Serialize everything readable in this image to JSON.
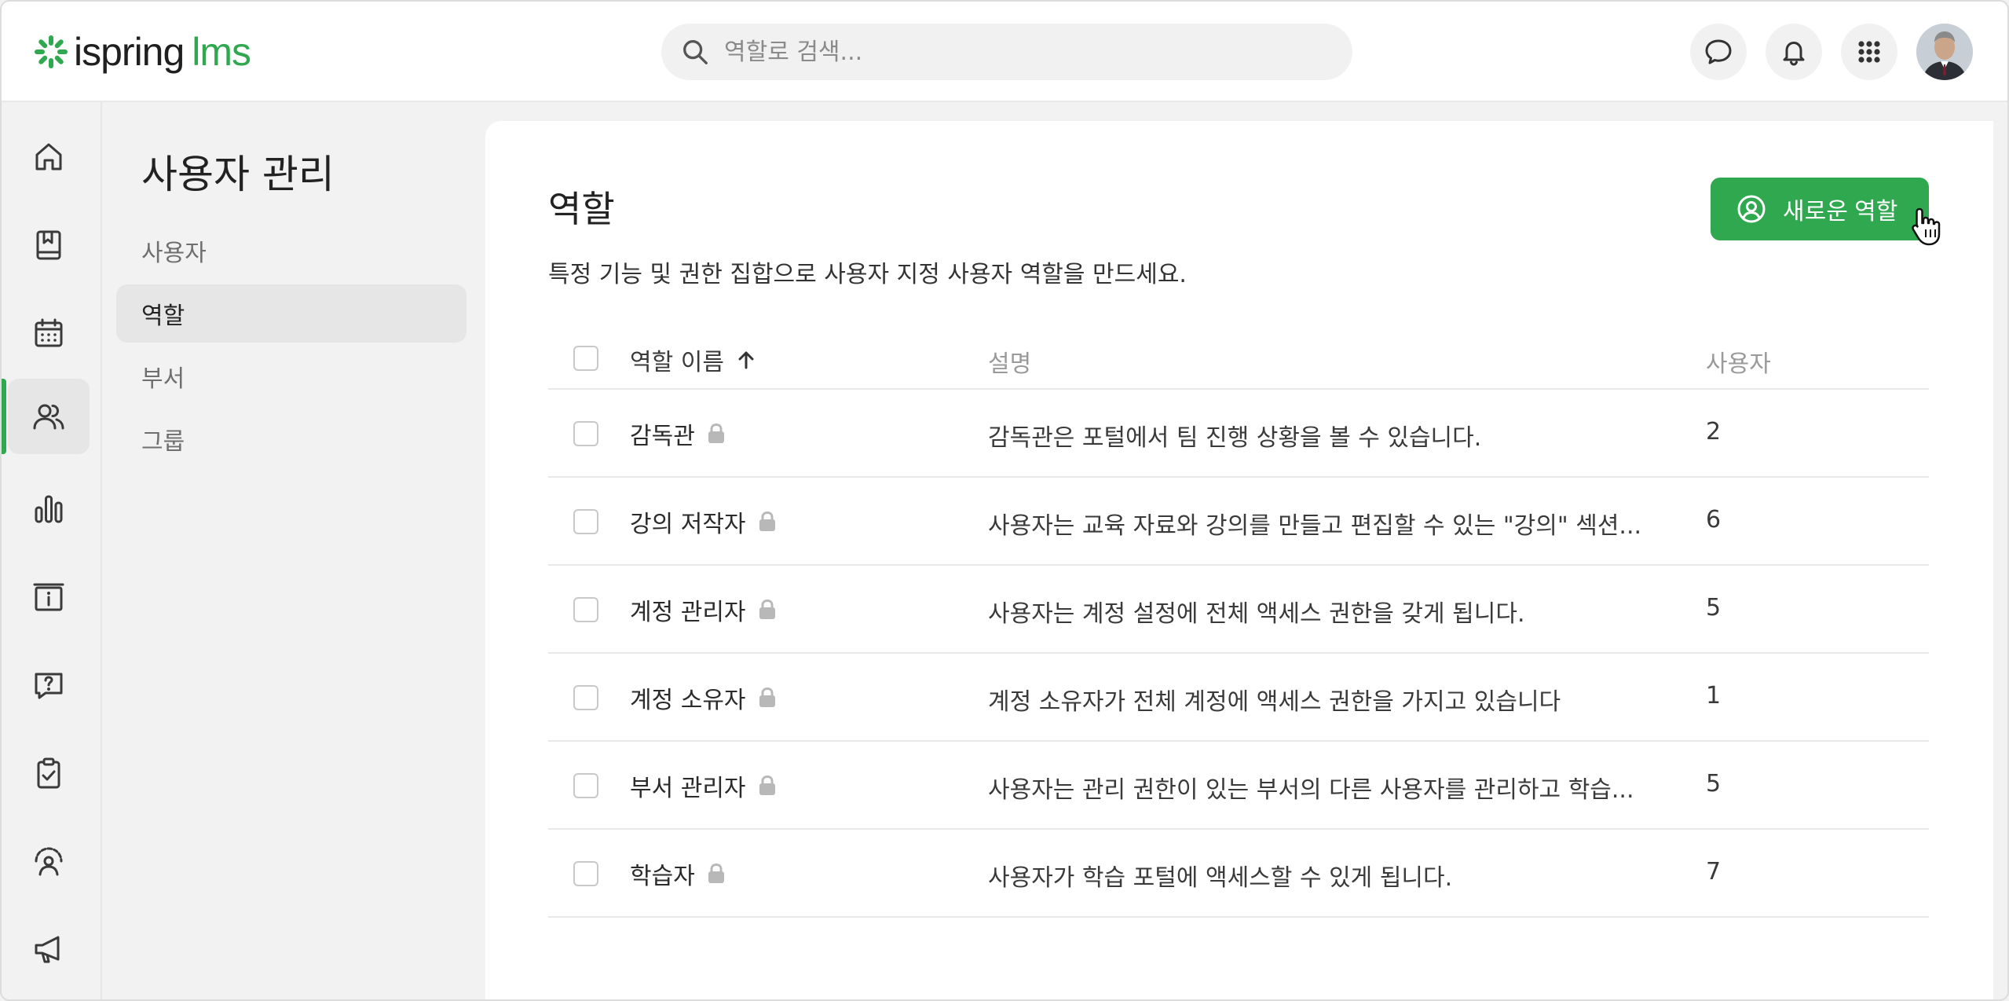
{
  "brand": {
    "name_part1": "ispring",
    "name_part2": "lms",
    "accent": "#2fa84f"
  },
  "search": {
    "placeholder": "역할로 검색..."
  },
  "topbar_icons": [
    "chat-icon",
    "bell-icon",
    "apps-grid-icon"
  ],
  "rail": {
    "items": [
      {
        "name": "home-icon"
      },
      {
        "name": "courses-book-icon"
      },
      {
        "name": "calendar-icon"
      },
      {
        "name": "users-icon",
        "active": true
      },
      {
        "name": "reports-chart-icon"
      },
      {
        "name": "info-icon"
      },
      {
        "name": "help-question-icon"
      },
      {
        "name": "tasks-clipboard-icon"
      },
      {
        "name": "performance-icon"
      },
      {
        "name": "announcement-megaphone-icon"
      }
    ]
  },
  "subnav": {
    "title": "사용자 관리",
    "items": [
      {
        "label": "사용자"
      },
      {
        "label": "역할",
        "active": true
      },
      {
        "label": "부서"
      },
      {
        "label": "그룹"
      }
    ]
  },
  "main": {
    "title": "역할",
    "description": "특정 기능 및 권한 집합으로 사용자 지정 사용자 역할을 만드세요.",
    "new_role_button": "새로운 역할",
    "table": {
      "headers": {
        "name": "역할 이름",
        "description": "설명",
        "users": "사용자"
      },
      "rows": [
        {
          "name": "감독관",
          "description": "감독관은 포털에서 팀 진행 상황을 볼 수 있습니다.",
          "users": "2"
        },
        {
          "name": "강의 저작자",
          "description": "사용자는 교육 자료와 강의를 만들고 편집할 수 있는 \"강의\" 섹션...",
          "users": "6"
        },
        {
          "name": "계정 관리자",
          "description": "사용자는 계정 설정에 전체 액세스 권한을 갖게 됩니다.",
          "users": "5"
        },
        {
          "name": "계정 소유자",
          "description": "계정 소유자가 전체 계정에 액세스 권한을 가지고 있습니다",
          "users": "1"
        },
        {
          "name": "부서 관리자",
          "description": "사용자는 관리 권한이 있는 부서의 다른 사용자를 관리하고 학습...",
          "users": "5"
        },
        {
          "name": "학습자",
          "description": "사용자가 학습 포털에 액세스할 수 있게 됩니다.",
          "users": "7"
        }
      ]
    }
  }
}
